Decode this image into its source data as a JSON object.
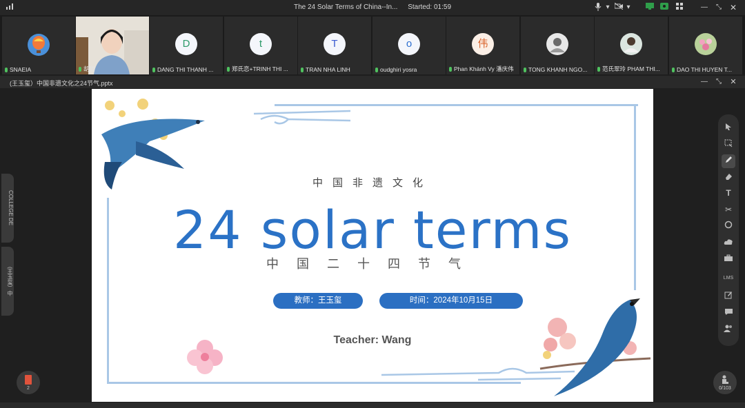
{
  "window": {
    "title": "The 24 Solar Terms of China--In...",
    "started": "Started: 01:59"
  },
  "participants": [
    {
      "name": "SNAEIA",
      "avatar_type": "balloon",
      "initial": ""
    },
    {
      "name": "胡甜",
      "avatar_type": "video",
      "initial": ""
    },
    {
      "name": "DANG THI THANH ...",
      "avatar_type": "letter",
      "initial": "D"
    },
    {
      "name": "郑氏恋+TRINH THI ...",
      "avatar_type": "letter",
      "initial": "t"
    },
    {
      "name": "TRAN NHA LINH",
      "avatar_type": "letter",
      "initial": "T"
    },
    {
      "name": "oudghiri yosra",
      "avatar_type": "letter",
      "initial": "o"
    },
    {
      "name": "Phan Khánh Vy 潘庆伟",
      "avatar_type": "letter",
      "initial": "伟"
    },
    {
      "name": "TONG KHANH NGO...",
      "avatar_type": "photo",
      "initial": ""
    },
    {
      "name": "范氏翠玲 PHAM THI...",
      "avatar_type": "photo",
      "initial": ""
    },
    {
      "name": "DAO THI HUYEN T...",
      "avatar_type": "photo",
      "initial": ""
    }
  ],
  "file": {
    "name": "(王玉玺）中国非遗文化之24节气.pptx"
  },
  "slide": {
    "subtitle_cn": "中国非遗文化",
    "title": "24 solar terms",
    "title_cn": "中国二十四节气",
    "teacher_pill": "教师：王玉玺",
    "date_pill": "时间：2024年10月15日",
    "teacher_en": "Teacher:   Wang"
  },
  "left_tabs": {
    "tab1": "COLLEGE DE",
    "tab2": "(王玉玺）中"
  },
  "bottom": {
    "left_badge": "2",
    "right_counter": "0/103"
  },
  "toolbar": {
    "lms_label": "LMS"
  },
  "colors": {
    "accent_blue": "#2b72c6",
    "pill_blue": "#2b6fc2",
    "frame_blue": "#a9c7e6"
  }
}
